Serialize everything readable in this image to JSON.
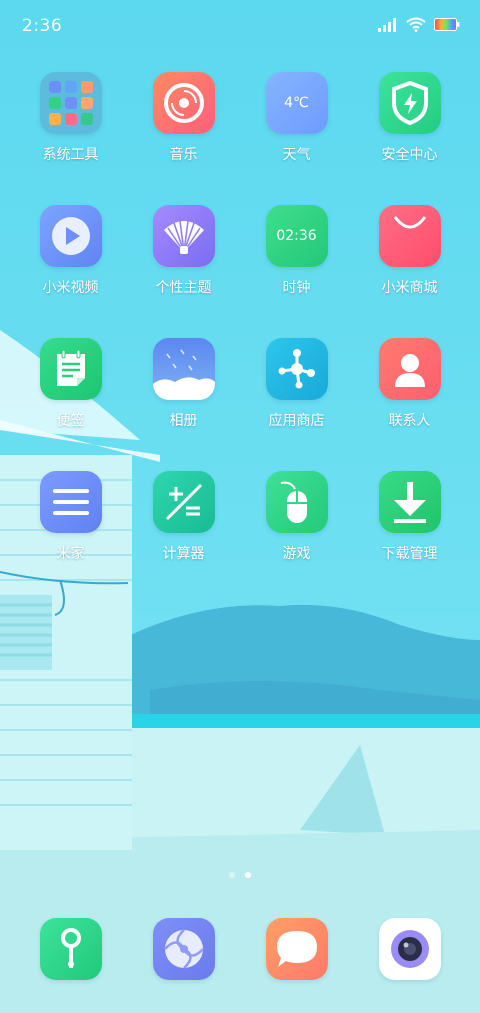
{
  "status_bar": {
    "time": "2:36",
    "icons": [
      "signal-icon",
      "wifi-icon",
      "battery-icon"
    ]
  },
  "apps": [
    {
      "label": "系统工具",
      "icon": "system-tools-folder-icon"
    },
    {
      "label": "音乐",
      "icon": "music-disc-icon"
    },
    {
      "label": "天气",
      "icon": "weather-icon",
      "icon_text": "4℃"
    },
    {
      "label": "安全中心",
      "icon": "security-shield-icon"
    },
    {
      "label": "小米视频",
      "icon": "video-play-icon"
    },
    {
      "label": "个性主题",
      "icon": "themes-fan-icon"
    },
    {
      "label": "时钟",
      "icon": "clock-icon",
      "icon_text": "02:36"
    },
    {
      "label": "小米商城",
      "icon": "mi-store-bag-icon"
    },
    {
      "label": "便签",
      "icon": "notes-icon"
    },
    {
      "label": "相册",
      "icon": "gallery-icon"
    },
    {
      "label": "应用商店",
      "icon": "app-store-icon"
    },
    {
      "label": "联系人",
      "icon": "contacts-icon"
    },
    {
      "label": "米家",
      "icon": "mijia-menu-icon"
    },
    {
      "label": "计算器",
      "icon": "calculator-icon"
    },
    {
      "label": "游戏",
      "icon": "game-mouse-icon"
    },
    {
      "label": "下载管理",
      "icon": "download-icon"
    }
  ],
  "page_indicator": {
    "pages": 2,
    "current": 2
  },
  "dock": [
    {
      "icon": "phone-icon"
    },
    {
      "icon": "browser-icon"
    },
    {
      "icon": "messages-icon"
    },
    {
      "icon": "camera-icon"
    }
  ],
  "colors": {
    "sky": "#5fd9ee",
    "music": "#ff6f6f",
    "weather": "#7aa8ff",
    "security": "#2fd88f",
    "video": "#6d8ff8",
    "themes": "#8e7bf5",
    "clock": "#33d483",
    "store": "#ff5b7a",
    "notes": "#26d07c",
    "gallery": "#5a8cf0",
    "appstore": "#24b9e3",
    "contacts": "#ff6d6d",
    "mijia": "#6e8ff5",
    "calculator": "#23c9a3",
    "game": "#2ed787",
    "download": "#2bd177"
  }
}
